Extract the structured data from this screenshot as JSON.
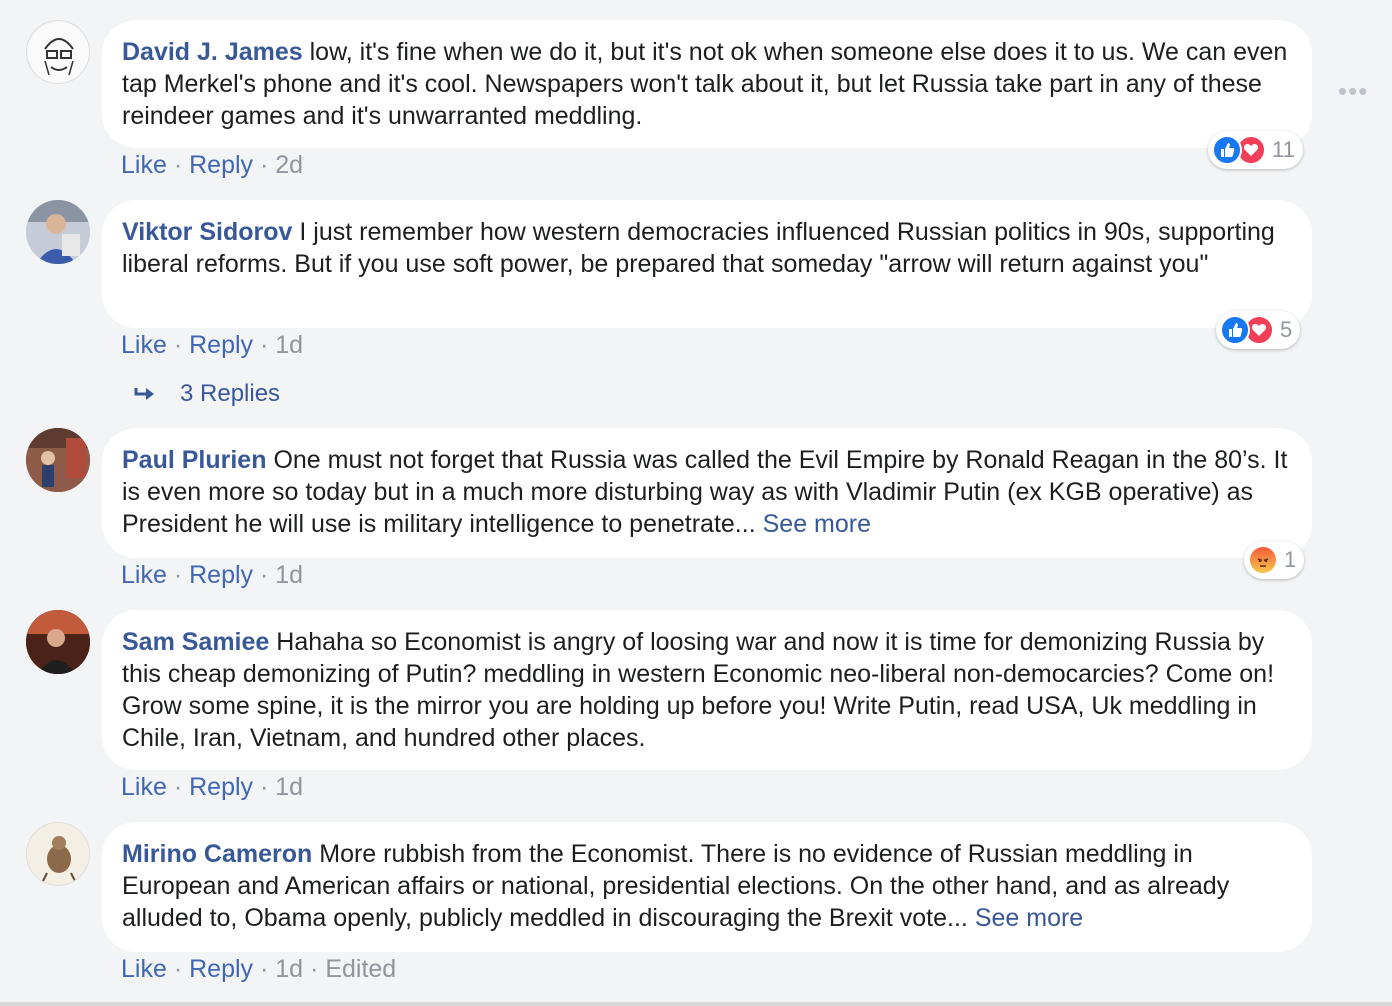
{
  "comments": [
    {
      "author": "David J. James",
      "text": "low, it's fine when we do it, but it's not ok when someone else does it to us. We can even tap Merkel's phone and it's cool. Newspapers won't talk about it, but let Russia take part in any of these reindeer games and it's unwarranted meddling.",
      "like": "Like",
      "reply": "Reply",
      "time": "2d",
      "reactions": [
        "like",
        "love"
      ],
      "reaction_count": "11"
    },
    {
      "author": "Viktor Sidorov",
      "text": "I just remember how western democracies influenced Russian politics in 90s, supporting liberal reforms. But if you use soft power, be prepared that someday \"arrow will return against you\"",
      "like": "Like",
      "reply": "Reply",
      "time": "1d",
      "reactions": [
        "like",
        "love"
      ],
      "reaction_count": "5",
      "replies_label": "3 Replies"
    },
    {
      "author": "Paul Plurien",
      "text": "One must not forget that Russia was called the Evil Empire by Ronald Reagan in the 80’s. It is even more so today but in a much more disturbing way as with Vladimir Putin (ex KGB operative) as President he will use is military intelligence to penetrate...",
      "see_more": "See more",
      "like": "Like",
      "reply": "Reply",
      "time": "1d",
      "reactions": [
        "angry"
      ],
      "reaction_count": "1"
    },
    {
      "author": "Sam Samiee",
      "text": "Hahaha so Economist is angry of loosing war and now it is time for demonizing Russia by this cheap demonizing of Putin? meddling in western Economic neo-liberal non-democarcies? Come on! Grow some spine, it is the mirror you are holding up before you! Write Putin, read USA, Uk meddling in Chile, Iran, Vietnam, and hundred other places.",
      "like": "Like",
      "reply": "Reply",
      "time": "1d"
    },
    {
      "author": "Mirino Cameron",
      "text": "More rubbish from the Economist. There is no evidence of Russian meddling in European and American affairs or national, presidential elections. On the other hand, and as already alluded to, Obama openly, publicly meddled in discouraging the Brexit vote...",
      "see_more": "See more",
      "like": "Like",
      "reply": "Reply",
      "time": "1d",
      "edited": "Edited"
    }
  ],
  "icons": {
    "more": "more-horizontal-icon",
    "reply_arrow": "reply-arrow-icon",
    "like": "thumbs-up-icon",
    "love": "heart-icon",
    "angry": "angry-face-icon"
  },
  "colors": {
    "author": "#385898",
    "action_link": "#4267b2",
    "meta": "#90949c",
    "like": "#1877f2",
    "love": "#f33e58"
  }
}
